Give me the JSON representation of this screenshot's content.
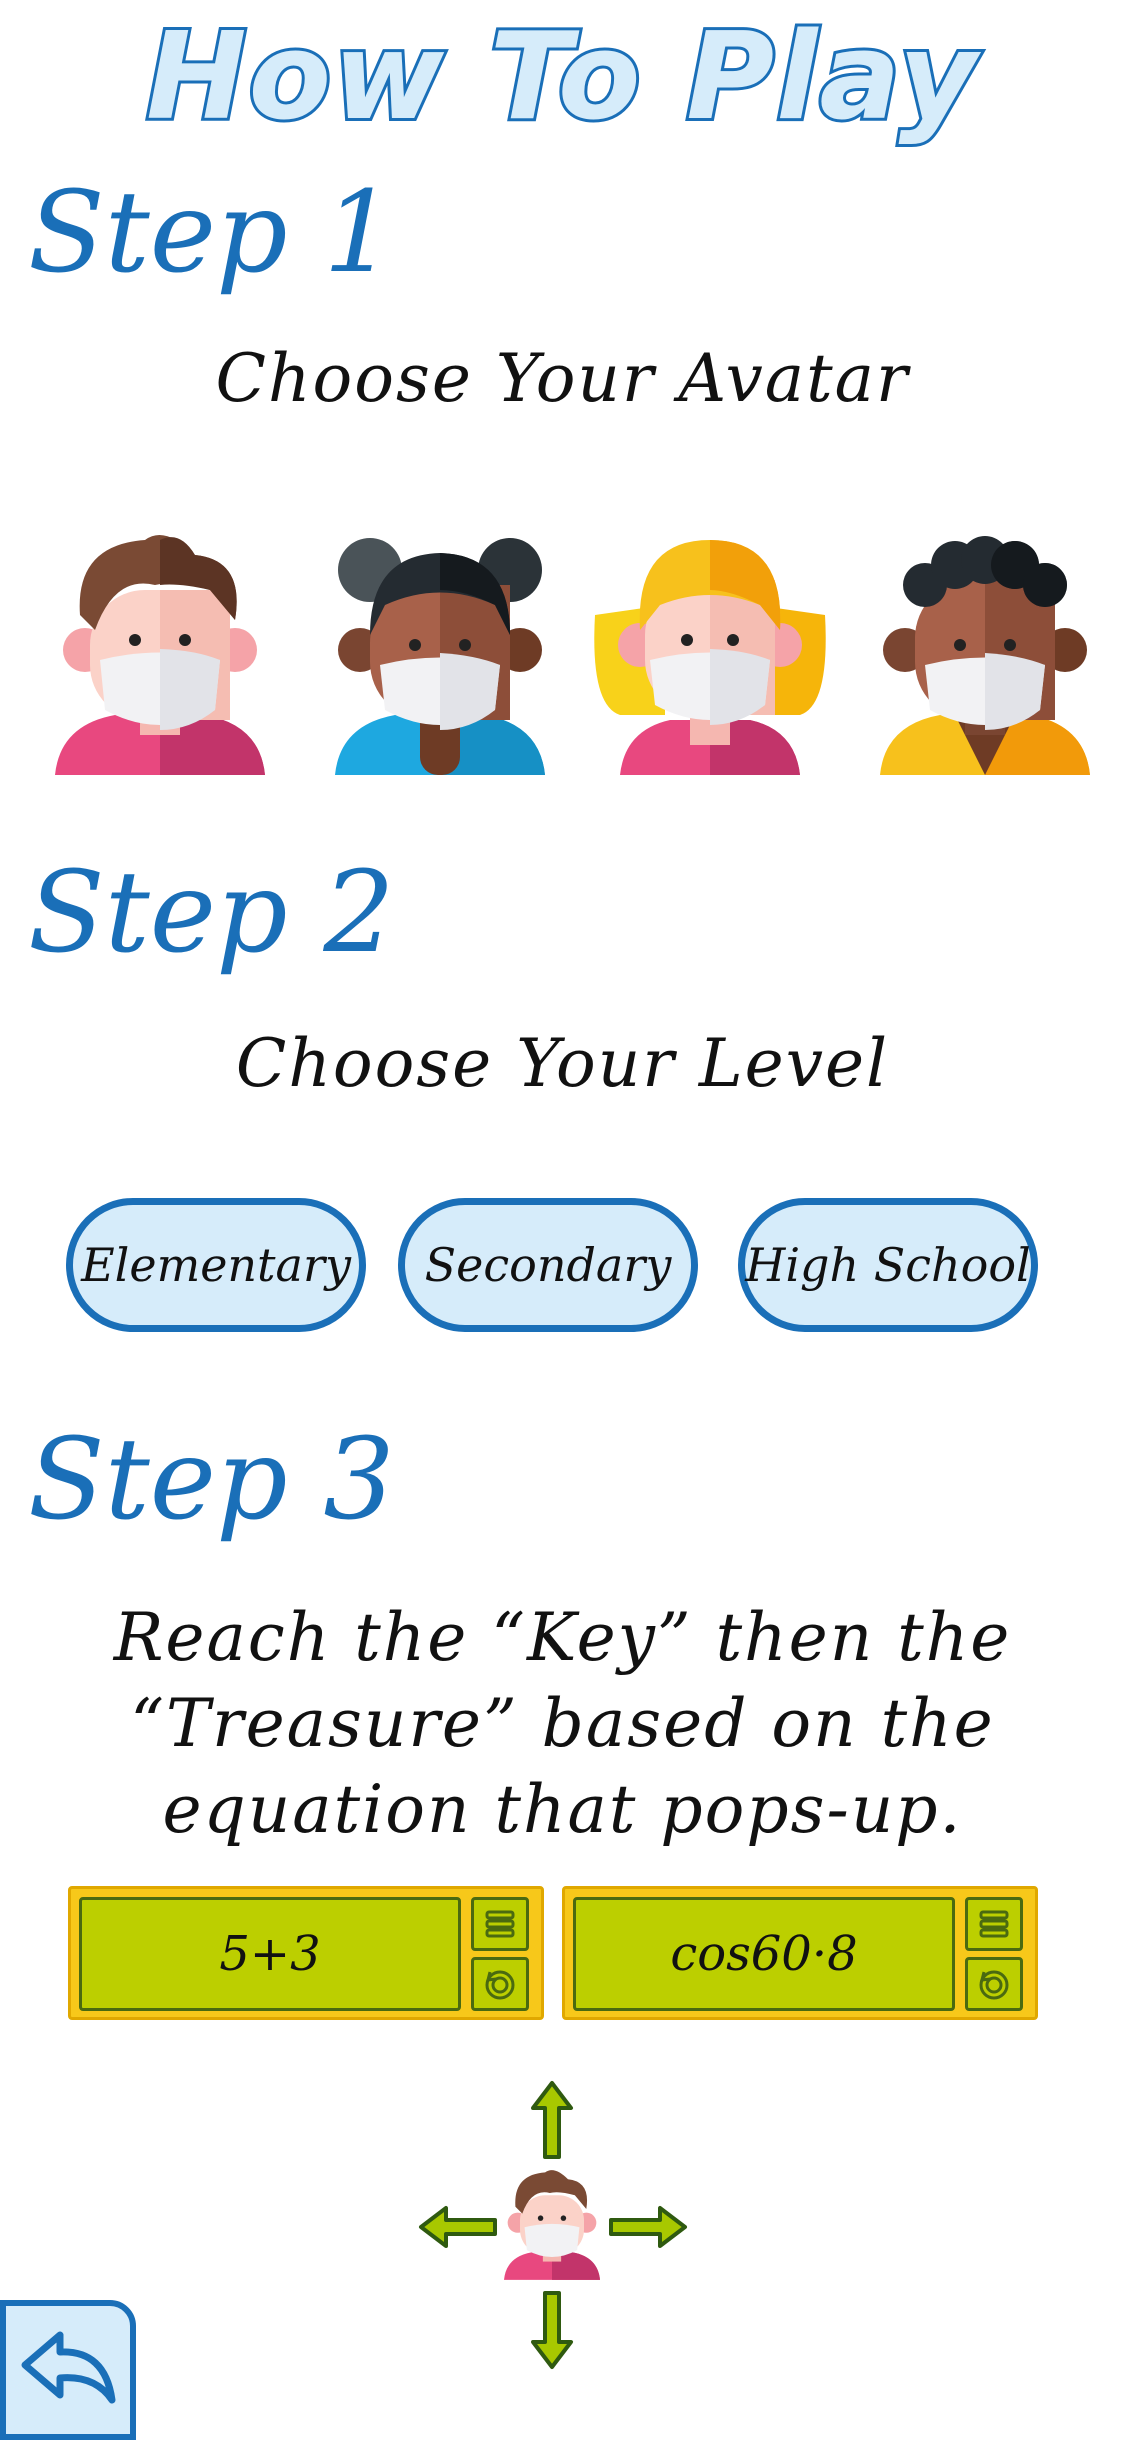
{
  "page": {
    "title": "How To Play"
  },
  "steps": [
    {
      "label": "Step 1",
      "subtitle": "Choose Your Avatar"
    },
    {
      "label": "Step 2",
      "subtitle": "Choose Your Level"
    },
    {
      "label": "Step 3",
      "instruction": "Reach the “Key” then the “Treasure” based on the equation that pops-up."
    }
  ],
  "avatars": [
    "boy-avatar-icon",
    "girl-buns-avatar-icon",
    "blonde-girl-avatar-icon",
    "curly-boy-avatar-icon"
  ],
  "levels": [
    "Elementary",
    "Secondary",
    "High School"
  ],
  "equations": [
    "5+3",
    "cos60·8"
  ],
  "controls": [
    "menu-icon",
    "refresh-icon",
    "arrow-up-icon",
    "arrow-left-icon",
    "arrow-right-icon",
    "arrow-down-icon"
  ],
  "colors": {
    "accent": "#1a6fb8",
    "light": "#d6ecfa",
    "panel": "#f7c81a",
    "screen": "#bccf00",
    "arrow": "#a8c800"
  },
  "back_icon": "back-arrow-icon"
}
